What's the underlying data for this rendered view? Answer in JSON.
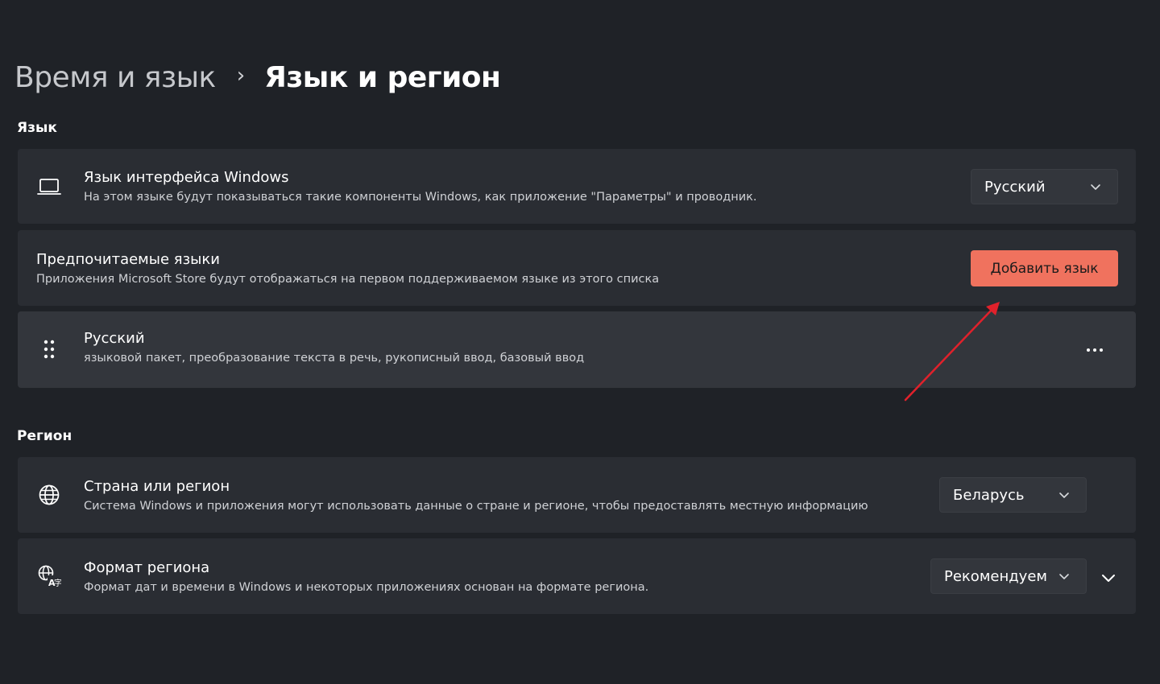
{
  "breadcrumb": {
    "parent": "Время и язык",
    "separator": "›",
    "current": "Язык и регион"
  },
  "language_section": {
    "title": "Язык",
    "display_language": {
      "title": "Язык интерфейса Windows",
      "subtitle": "На этом языке будут показываться такие компоненты Windows, как приложение \"Параметры\" и проводник.",
      "value": "Русский",
      "icon": "laptop-icon"
    },
    "preferred_languages": {
      "title": "Предпочитаемые языки",
      "subtitle": "Приложения Microsoft Store будут отображаться на первом поддерживаемом языке из этого списка",
      "button_label": "Добавить язык",
      "button_color": "#f0725e"
    },
    "installed_language": {
      "title": "Русский",
      "subtitle": "языковой пакет, преобразование текста в речь, рукописный ввод, базовый ввод",
      "icon": "drag-handle-icon",
      "more_label": "···"
    }
  },
  "region_section": {
    "title": "Регион",
    "country": {
      "title": "Страна или регион",
      "subtitle": "Система Windows и приложения могут использовать данные о стране и регионе, чтобы предоставлять местную информацию",
      "value": "Беларусь",
      "icon": "globe-icon"
    },
    "format": {
      "title": "Формат региона",
      "subtitle": "Формат дат и времени в Windows и некоторых приложениях основан на формате региона.",
      "value": "Рекомендуем",
      "icon": "regional-format-icon"
    }
  },
  "annotation": {
    "arrow_color": "#e0212b"
  }
}
